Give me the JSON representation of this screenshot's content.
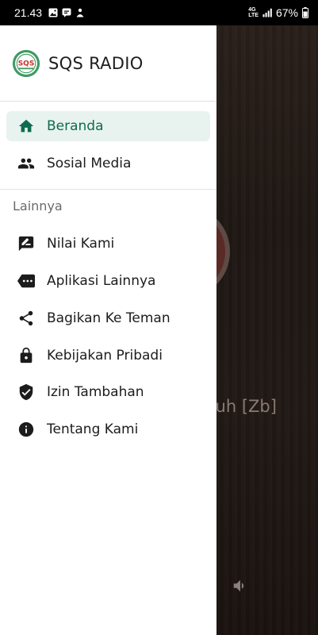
{
  "status_bar": {
    "time": "21.43",
    "left_icons": [
      "image-icon",
      "message-icon",
      "app-icon"
    ],
    "network": [
      "4G",
      "LTE"
    ],
    "battery": "67%"
  },
  "drawer": {
    "app_title": "SQS RADIO",
    "logo_text": "SQS",
    "main_items": [
      {
        "label": "Beranda",
        "icon": "home-icon",
        "active": true
      },
      {
        "label": "Sosial Media",
        "icon": "people-icon",
        "active": false
      }
    ],
    "section_title": "Lainnya",
    "other_items": [
      {
        "label": "Nilai Kami",
        "icon": "rate-icon"
      },
      {
        "label": "Aplikasi Lainnya",
        "icon": "more-apps-icon"
      },
      {
        "label": "Bagikan Ke Teman",
        "icon": "share-icon"
      },
      {
        "label": "Kebijakan Pribadi",
        "icon": "lock-icon"
      },
      {
        "label": "Izin Tambahan",
        "icon": "shield-check-icon"
      },
      {
        "label": "Tentang Kami",
        "icon": "info-icon"
      }
    ]
  },
  "background": {
    "track_text": "ntuh [Zb]"
  },
  "colors": {
    "accent": "#0e6b4f",
    "active_bg": "#e8f3ef"
  }
}
